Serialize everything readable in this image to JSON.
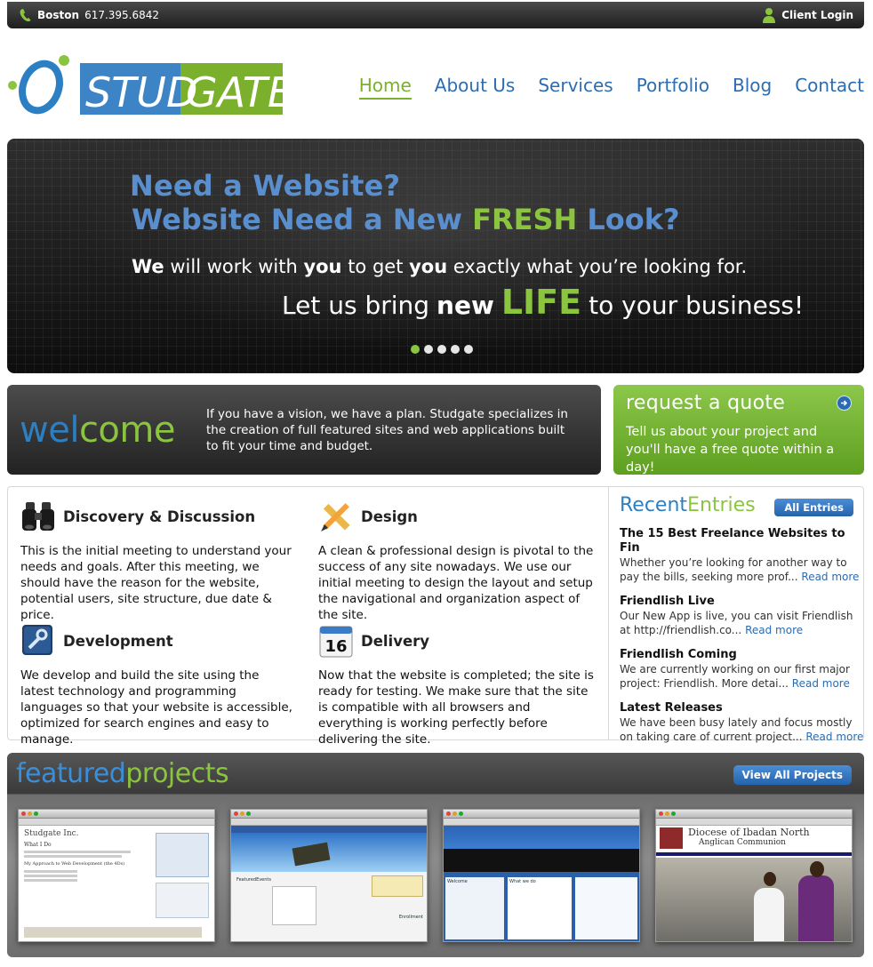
{
  "topbar": {
    "city": "Boston",
    "phone": "617.395.6842",
    "client_login": "Client Login"
  },
  "logo": {
    "text_left": "STUD",
    "text_right": "GATE"
  },
  "nav": {
    "items": [
      {
        "label": "Home",
        "active": true
      },
      {
        "label": "About Us"
      },
      {
        "label": "Services"
      },
      {
        "label": "Portfolio"
      },
      {
        "label": "Blog"
      },
      {
        "label": "Contact"
      }
    ]
  },
  "hero": {
    "line1": "Need a Website?",
    "line2_start": "Website Need a New ",
    "line2_fresh": "FRESH",
    "line2_end": " Look?",
    "p1_we": "We",
    "p1_a": " will work with ",
    "p1_you1": "you",
    "p1_b": " to get ",
    "p1_you2": "you",
    "p1_c": " exactly what you’re looking for.",
    "p2_a": "Let us bring",
    "p2_new": "new",
    "p2_life": "LIFE",
    "p2_b": "to your business!",
    "slides": 5,
    "active_slide": 1
  },
  "welcome": {
    "title_a": "wel",
    "title_b": "come",
    "text": "If you have a vision, we have a plan. Studgate specializes in the creation of full featured sites and web applications built to fit your time and budget."
  },
  "quote": {
    "title": "request a quote",
    "text": "Tell us about your project and you'll have a free quote within a day!"
  },
  "services": [
    {
      "title": "Discovery & Discussion",
      "icon": "binoculars-icon",
      "text": "This is the initial meeting to understand your needs and goals. After this meeting, we should have the reason for the website, potential users, site structure, due date & price."
    },
    {
      "title": "Design",
      "icon": "pencil-ruler-icon",
      "text": "A clean & professional design is pivotal to the success of any site nowadays. We use our initial meeting to design the layout and setup the navigational and organization aspect of the site."
    },
    {
      "title": "Development",
      "icon": "wrench-icon",
      "text": "We develop and build the site using the latest technology and programming languages so that your website is accessible, optimized for search engines and easy to manage."
    },
    {
      "title": "Delivery",
      "icon": "calendar-icon",
      "calendar_day": "16",
      "text": "Now that the website is completed; the site is ready for testing. We make sure that the site is compatible with all browsers and everything is working perfectly before delivering the site."
    }
  ],
  "recent": {
    "title_a": "Recent",
    "title_b": "Entries",
    "all_button": "All Entries",
    "read_more": "Read more",
    "entries": [
      {
        "title": "The 15 Best Freelance Websites to Fin",
        "excerpt": "Whether you’re looking for another way to pay the bills, seeking more prof..."
      },
      {
        "title": "Friendlish Live",
        "excerpt": " Our New App is live, you can visit Friendlish at http://friendlish.co..."
      },
      {
        "title": "Friendlish Coming",
        "excerpt": "We are currently working on our first major project: Friendlish. More detai..."
      },
      {
        "title": "Latest Releases",
        "excerpt": "We have been busy lately and focus mostly on taking care of current project..."
      }
    ]
  },
  "featured": {
    "title_a": "featured",
    "title_b": "projects",
    "view_all": "View All Projects",
    "projects": [
      {
        "site_title": "Studgate Inc.",
        "heading": "What I Do",
        "sub": "My Approach to Web Development (the 4Ds)"
      },
      {
        "site_title": "",
        "heading": "FeaturedEvents",
        "sub": "Enrollment"
      },
      {
        "site_title": "",
        "heading": "Welcome",
        "sub": "What we do"
      },
      {
        "site_title": "Diocese of Ibadan North",
        "heading": "Anglican Communion",
        "sub": ""
      }
    ]
  }
}
